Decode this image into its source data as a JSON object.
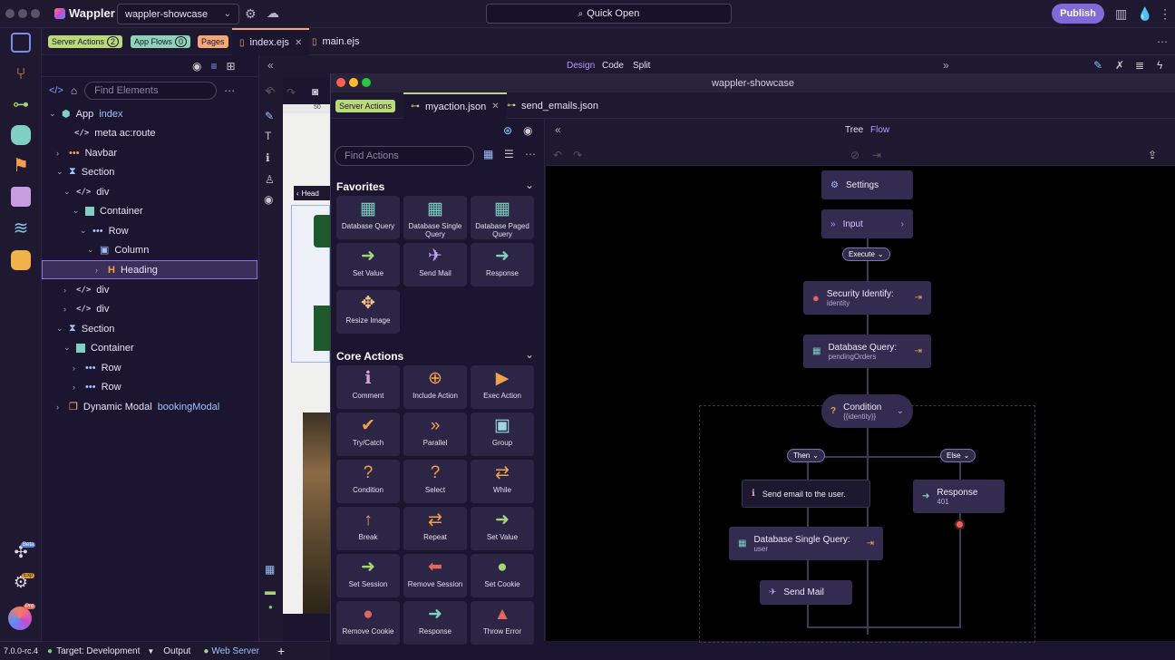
{
  "app": {
    "name": "Wappler",
    "project": "wappler-showcase",
    "quick_open": "Quick Open",
    "publish": "Publish",
    "version": "7.0.0-rc.4"
  },
  "tabs": {
    "badges": [
      {
        "label": "Server Actions",
        "count": "2",
        "color": "#b9d97a"
      },
      {
        "label": "App Flows",
        "count": "0",
        "color": "#8ed3b8"
      },
      {
        "label": "Pages",
        "color": "#f2a977"
      }
    ],
    "files": [
      {
        "label": "index.ejs",
        "active": true
      },
      {
        "label": "main.ejs",
        "active": false
      }
    ]
  },
  "design_modes": {
    "design": "Design",
    "code": "Code",
    "split": "Split"
  },
  "left_panel": {
    "search_placeholder": "Find Elements",
    "tree": [
      {
        "label": "App",
        "extra": "index"
      },
      {
        "label": "meta ac:route"
      },
      {
        "label": "Navbar"
      },
      {
        "label": "Section"
      },
      {
        "label": "div"
      },
      {
        "label": "Container"
      },
      {
        "label": "Row"
      },
      {
        "label": "Column"
      },
      {
        "label": "Heading"
      },
      {
        "label": "div"
      },
      {
        "label": "div"
      },
      {
        "label": "Section"
      },
      {
        "label": "Container"
      },
      {
        "label": "Row"
      },
      {
        "label": "Row"
      },
      {
        "label": "Dynamic Modal",
        "extra": "bookingModal"
      }
    ]
  },
  "canvas": {
    "heading_chip": "Head",
    "ruler": "50"
  },
  "window": {
    "title": "wappler-showcase",
    "badge": "Server Actions",
    "tabs": [
      {
        "label": "myaction.json"
      },
      {
        "label": "send_emails.json"
      }
    ],
    "actions_search": "Find Actions",
    "favorites_title": "Favorites",
    "favorites": [
      {
        "label": "Database Query",
        "icon": "db-query",
        "color": "#7fd0c3"
      },
      {
        "label": "Database Single Query",
        "icon": "db-single",
        "color": "#7fd0c3"
      },
      {
        "label": "Database Paged Query",
        "icon": "db-paged",
        "color": "#7fd0c3"
      },
      {
        "label": "Set Value",
        "icon": "arrow-right",
        "color": "#a6d478"
      },
      {
        "label": "Send Mail",
        "icon": "paper-plane",
        "color": "#b9a3f0"
      },
      {
        "label": "Response",
        "icon": "arrow-right",
        "color": "#7fd0c3"
      },
      {
        "label": "Resize Image",
        "icon": "move",
        "color": "#f4c285"
      }
    ],
    "core_title": "Core Actions",
    "core": [
      {
        "label": "Comment",
        "icon": "info",
        "color": "#d9a4d6"
      },
      {
        "label": "Include Action",
        "icon": "plus",
        "color": "#f2a14b"
      },
      {
        "label": "Exec Action",
        "icon": "play",
        "color": "#f2a14b"
      },
      {
        "label": "Try/Catch",
        "icon": "check",
        "color": "#f2a14b"
      },
      {
        "label": "Parallel",
        "icon": "double-chevron",
        "color": "#f2a14b"
      },
      {
        "label": "Group",
        "icon": "group",
        "color": "#9fd4e0"
      },
      {
        "label": "Condition",
        "icon": "question",
        "color": "#f2a14b"
      },
      {
        "label": "Select",
        "icon": "question",
        "color": "#f2a14b"
      },
      {
        "label": "While",
        "icon": "repeat",
        "color": "#f2a14b"
      },
      {
        "label": "Break",
        "icon": "arrow-up",
        "color": "#f2a14b"
      },
      {
        "label": "Repeat",
        "icon": "repeat",
        "color": "#f2a14b"
      },
      {
        "label": "Set Value",
        "icon": "arrow-right",
        "color": "#a6d478"
      },
      {
        "label": "Set Session",
        "icon": "arrow-right",
        "color": "#a6d478"
      },
      {
        "label": "Remove Session",
        "icon": "arrow-left",
        "color": "#e0685c"
      },
      {
        "label": "Set Cookie",
        "icon": "cookie",
        "color": "#a6d478"
      },
      {
        "label": "Remove Cookie",
        "icon": "cookie",
        "color": "#e0685c"
      },
      {
        "label": "Response",
        "icon": "arrow-right",
        "color": "#7fd0c3"
      },
      {
        "label": "Throw Error",
        "icon": "warning",
        "color": "#e0685c"
      }
    ],
    "view_modes": {
      "tree": "Tree",
      "flow": "Flow"
    },
    "flow": {
      "settings": "Settings",
      "input": "Input",
      "execute": "Execute",
      "security": {
        "title": "Security Identify:",
        "sub": "identity"
      },
      "dbquery": {
        "title": "Database Query:",
        "sub": "pendingOrders"
      },
      "condition": {
        "title": "Condition",
        "sub": "{{identity}}"
      },
      "then": "Then",
      "else": "Else",
      "comment": "Send email to the user.",
      "response": {
        "title": "Response",
        "sub": "401"
      },
      "dbsingle": {
        "title": "Database Single Query:",
        "sub": "user"
      },
      "sendmail": "Send Mail"
    }
  },
  "status_bar": {
    "target": "Target: Development",
    "output": "Output",
    "web_server": "Web Server"
  },
  "activity_badges": {
    "beta": "Beta",
    "exp": "Exp",
    "pro": "Pro"
  }
}
